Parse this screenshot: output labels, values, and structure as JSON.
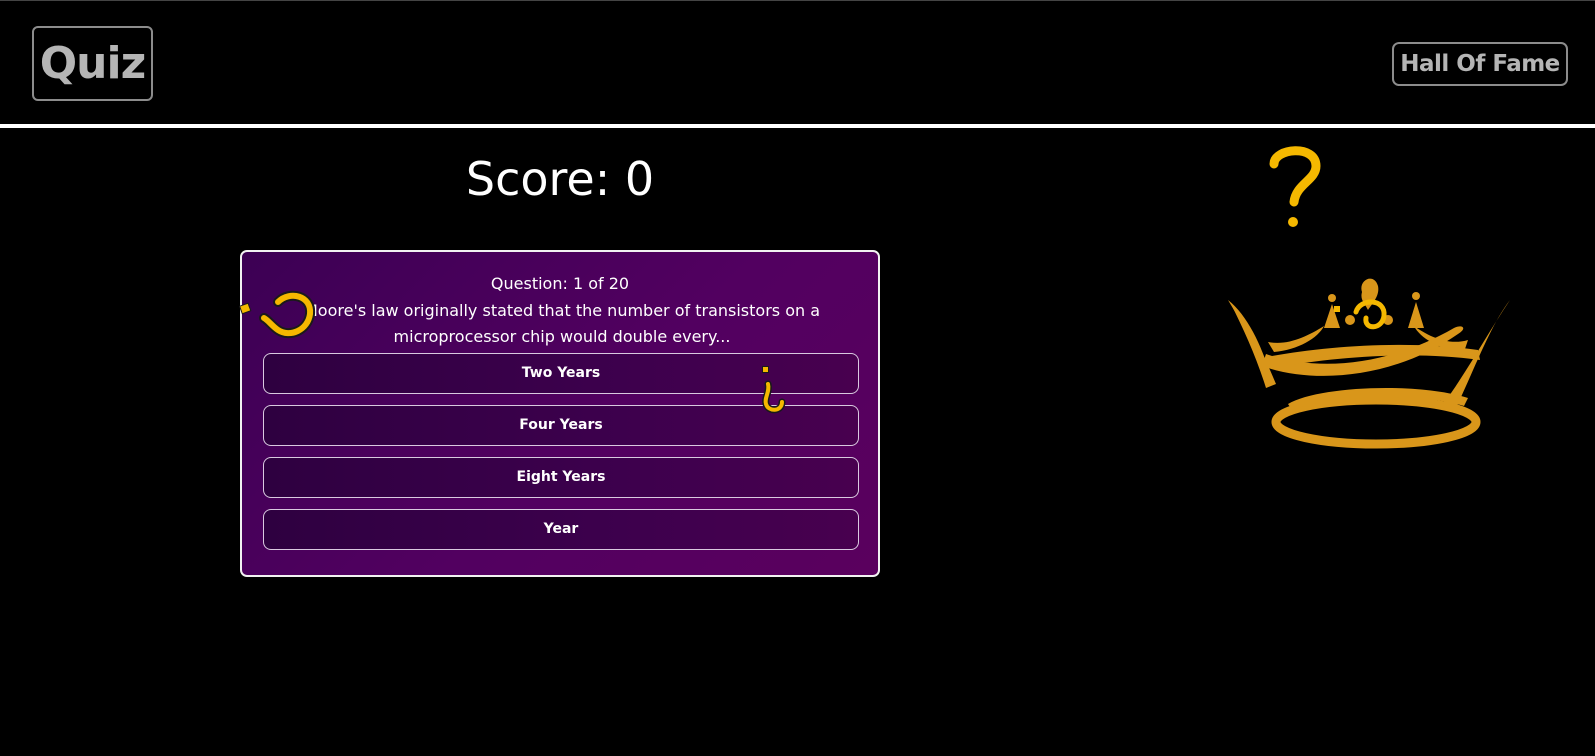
{
  "header": {
    "logo": "Quiz",
    "hall_of_fame_label": "Hall Of Fame"
  },
  "score": {
    "label": "Score: 0"
  },
  "question": {
    "counter": "Question: 1 of 20",
    "text": "Moore's law originally stated that the number of transistors on a microprocessor chip would double every..."
  },
  "answers": [
    {
      "label": "Two Years"
    },
    {
      "label": "Four Years"
    },
    {
      "label": "Eight Years"
    },
    {
      "label": "Year"
    }
  ],
  "colors": {
    "background": "#000000",
    "card_gradient_start": "#3c0054",
    "card_gradient_end": "#5a005e",
    "gold": "#f5b800",
    "crown": "#d9961a",
    "border_gray": "#8c8c8c"
  },
  "icons": {
    "question_mark": "question-mark-icon",
    "crown": "crown-icon"
  }
}
